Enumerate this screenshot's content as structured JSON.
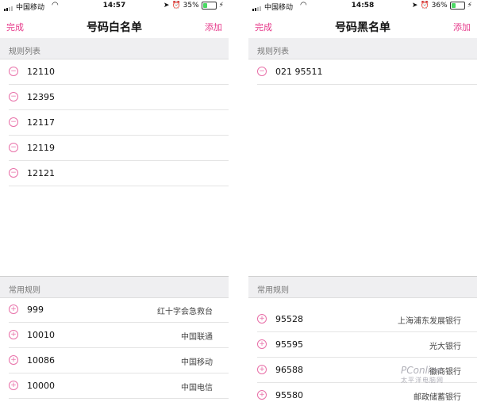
{
  "screens": [
    {
      "status": {
        "carrier": "中国移动",
        "time": "14:57",
        "battery": "35%",
        "battery_level": 0.35
      },
      "nav": {
        "left": "完成",
        "title": "号码白名单",
        "right": "添加"
      },
      "rules_header": "规则列表",
      "rules": [
        "12110",
        "12395",
        "12117",
        "12119",
        "12121"
      ],
      "common_header": "常用规则",
      "common": [
        {
          "number": "999",
          "name": "红十字会急救台"
        },
        {
          "number": "10010",
          "name": "中国联通"
        },
        {
          "number": "10086",
          "name": "中国移动"
        },
        {
          "number": "10000",
          "name": "中国电信"
        }
      ]
    },
    {
      "status": {
        "carrier": "中国移动",
        "time": "14:58",
        "battery": "36%",
        "battery_level": 0.36
      },
      "nav": {
        "left": "完成",
        "title": "号码黑名单",
        "right": "添加"
      },
      "rules_header": "规则列表",
      "rules": [
        "021 95511"
      ],
      "common_header": "常用规则",
      "common": [
        {
          "number": "95528",
          "name": "上海浦东发展银行"
        },
        {
          "number": "95595",
          "name": "光大银行"
        },
        {
          "number": "96588",
          "name": "徽商银行"
        },
        {
          "number": "95580",
          "name": "邮政储蓄银行"
        }
      ]
    }
  ],
  "icons": {
    "remove": "minus-circle-icon",
    "add": "plus-circle-icon"
  },
  "colors": {
    "accent": "#e6398a",
    "battery": "#4cd964"
  },
  "watermark": {
    "brand": "PConline",
    "sub": "太平洋电脑网"
  }
}
